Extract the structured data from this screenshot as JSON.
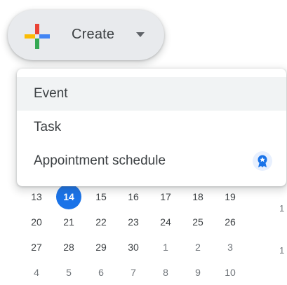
{
  "create_button": {
    "label": "Create"
  },
  "menu": {
    "items": [
      {
        "label": "Event"
      },
      {
        "label": "Task"
      },
      {
        "label": "Appointment schedule"
      }
    ]
  },
  "mini_calendar": {
    "rows": [
      [
        "13",
        "14",
        "15",
        "16",
        "17",
        "18",
        "19"
      ],
      [
        "20",
        "21",
        "22",
        "23",
        "24",
        "25",
        "26"
      ],
      [
        "27",
        "28",
        "29",
        "30",
        "1",
        "2",
        "3"
      ],
      [
        "4",
        "5",
        "6",
        "7",
        "8",
        "9",
        "10"
      ]
    ],
    "today": "14"
  },
  "edge_glyphs": [
    "1",
    "1"
  ],
  "colors": {
    "today": "#1a73e8",
    "menu_hover": "#f1f3f4",
    "create_bg": "#e8eaed"
  }
}
